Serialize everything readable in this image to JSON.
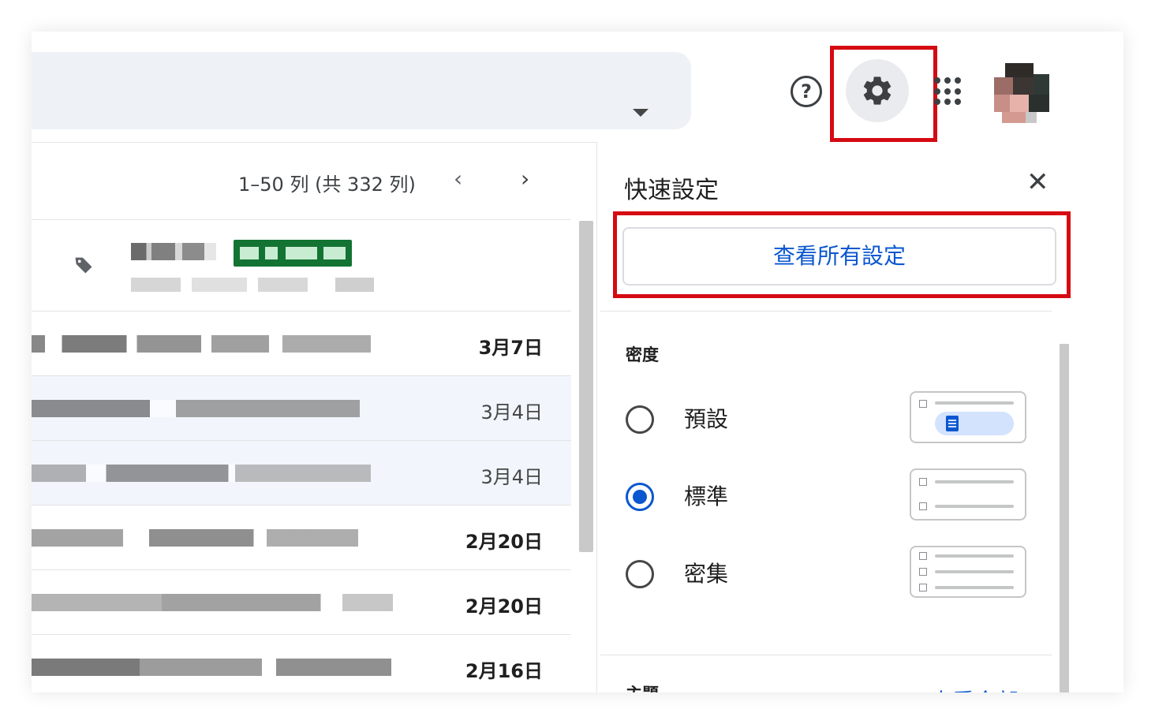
{
  "header": {
    "help_label": "?",
    "settings_icon": "gear-icon",
    "apps_icon": "apps-grid-icon"
  },
  "list": {
    "pagination": "1–50 列 (共 332 列)",
    "prev_label": "‹",
    "next_label": "›",
    "rows": [
      {
        "date": "3月7日",
        "state": "unread"
      },
      {
        "date": "3月4日",
        "state": "read"
      },
      {
        "date": "3月4日",
        "state": "read"
      },
      {
        "date": "2月20日",
        "state": "unread"
      },
      {
        "date": "2月20日",
        "state": "unread"
      },
      {
        "date": "2月16日",
        "state": "unread"
      }
    ]
  },
  "quick_settings": {
    "title": "快速設定",
    "close_label": "✕",
    "see_all_button": "查看所有設定",
    "density_heading": "密度",
    "density_options": [
      {
        "label": "預設",
        "selected": false
      },
      {
        "label": "標準",
        "selected": true
      },
      {
        "label": "密集",
        "selected": false
      }
    ],
    "theme_heading": "主題",
    "view_all_link": "查看全部"
  },
  "colors": {
    "highlight": "#d50a12",
    "accent": "#0b57d0",
    "promo_badge": "#137333"
  }
}
